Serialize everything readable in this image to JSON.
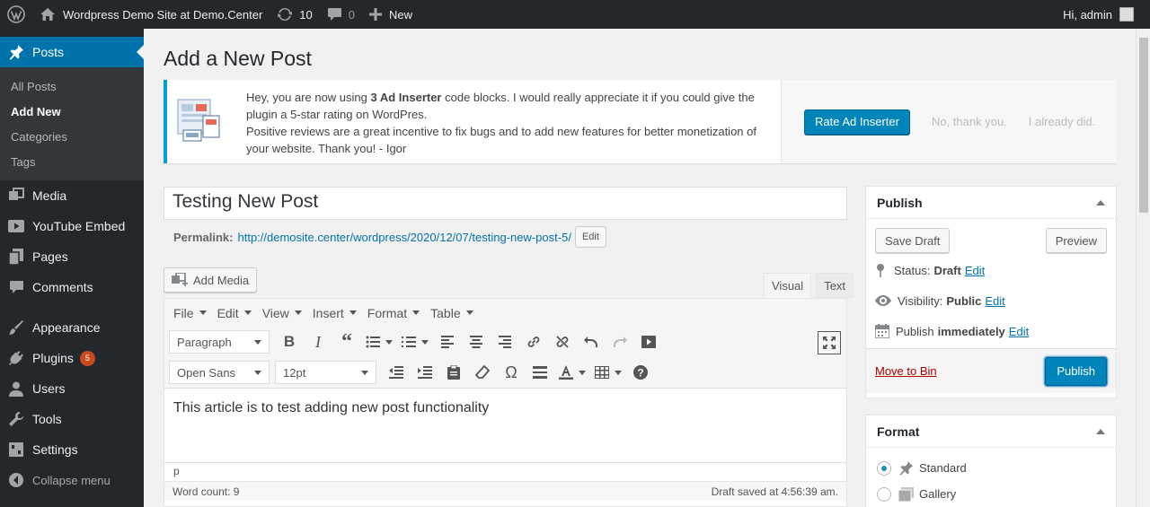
{
  "adminbar": {
    "site_title": "Wordpress Demo Site at Demo.Center",
    "updates_count": "10",
    "comments_count": "0",
    "new_label": "New",
    "greeting": "Hi, admin"
  },
  "menu": {
    "posts": "Posts",
    "sub": [
      "All Posts",
      "Add New",
      "Categories",
      "Tags"
    ],
    "media": "Media",
    "youtube": "YouTube Embed",
    "pages": "Pages",
    "comments": "Comments",
    "appearance": "Appearance",
    "plugins": "Plugins",
    "plugins_badge": "5",
    "users": "Users",
    "tools": "Tools",
    "settings": "Settings",
    "collapse": "Collapse menu"
  },
  "page": {
    "title": "Add a New Post"
  },
  "notice": {
    "line1_pre": "Hey, you are now using ",
    "line1_bold": "3 Ad Inserter",
    "line1_post": " code blocks. I would really appreciate it if you could give the plugin a 5-star rating on WordPres.",
    "line2": "Positive reviews are a great incentive to fix bugs and to add new features for better monetization of your website. Thank you! - Igor",
    "rate_button": "Rate Ad Inserter",
    "no_thanks": "No, thank you.",
    "already": "I already did."
  },
  "post": {
    "title": "Testing New Post",
    "permalink_label": "Permalink:",
    "permalink_base": "http://demosite.center/wordpress/2020/12/07/",
    "permalink_slug": "testing-new-post-5/",
    "permalink_edit": "Edit",
    "content": "This article is to test adding new post functionality"
  },
  "editor": {
    "add_media": "Add Media",
    "tab_visual": "Visual",
    "tab_text": "Text",
    "menubar": [
      "File",
      "Edit",
      "View",
      "Insert",
      "Format",
      "Table"
    ],
    "block_format": "Paragraph",
    "font_family": "Open Sans",
    "font_size": "12pt",
    "path": "p",
    "word_count": "Word count: 9",
    "draft_saved": "Draft saved at 4:56:39 am."
  },
  "publish_box": {
    "title": "Publish",
    "save_draft": "Save Draft",
    "preview": "Preview",
    "status_label": "Status:",
    "status_value": "Draft",
    "visibility_label": "Visibility:",
    "visibility_value": "Public",
    "publish_label": "Publish",
    "publish_value": "immediately",
    "edit": "Edit",
    "move_to_bin": "Move to Bin",
    "publish_button": "Publish"
  },
  "format_box": {
    "title": "Format",
    "options": [
      "Standard",
      "Gallery"
    ],
    "selected": "Standard"
  },
  "colors": {
    "accent": "#0073aa",
    "adminbar": "#23282d",
    "primary_button": "#0085ba",
    "notice_border": "#00a0d2",
    "badge": "#ca4a1f"
  }
}
